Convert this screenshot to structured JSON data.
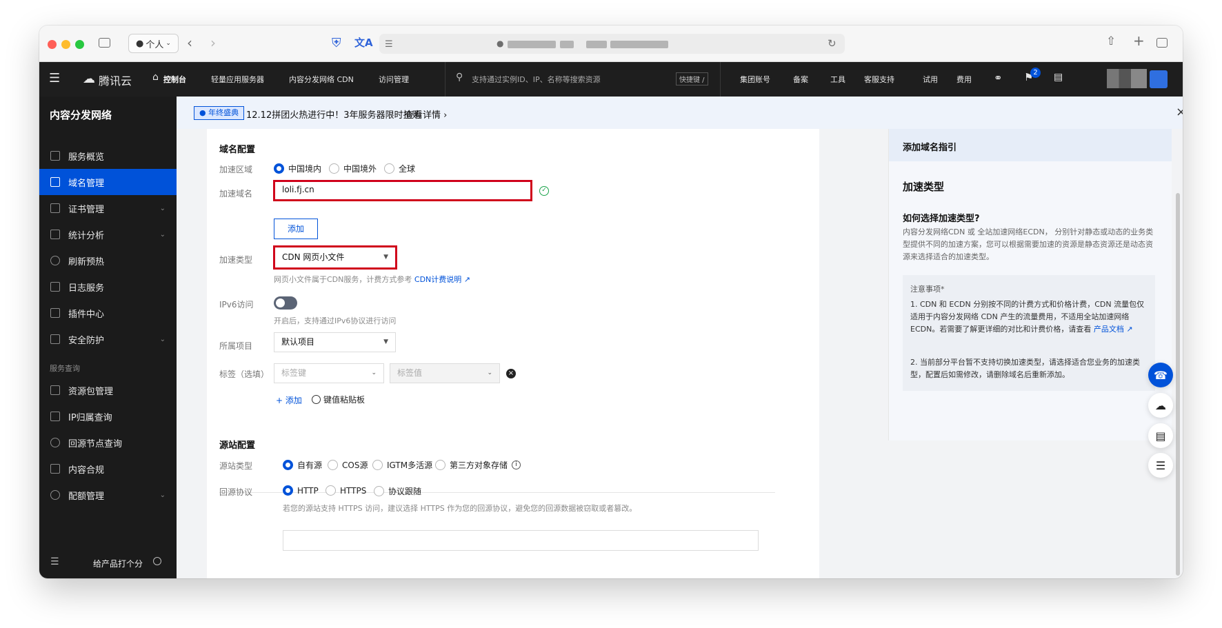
{
  "browser": {
    "profile_label": "个人"
  },
  "topnav": {
    "brand": "腾讯云",
    "console": "控制台",
    "items": [
      "轻量应用服务器",
      "内容分发网络 CDN",
      "访问管理"
    ],
    "search_placeholder": "支持通过实例ID、IP、名称等搜索资源",
    "shortcut": "快捷键 /",
    "right_items": [
      "集团账号",
      "备案",
      "工具",
      "客服支持",
      "试用",
      "费用"
    ],
    "notification_count": "2"
  },
  "sidebar": {
    "title": "内容分发网络",
    "items": [
      {
        "label": "服务概览",
        "icon": "grid-icon"
      },
      {
        "label": "域名管理",
        "icon": "domain-icon",
        "active": true
      },
      {
        "label": "证书管理",
        "icon": "certificate-icon"
      },
      {
        "label": "统计分析",
        "icon": "bar-chart-icon"
      },
      {
        "label": "刷新预热",
        "icon": "refresh-icon"
      },
      {
        "label": "日志服务",
        "icon": "log-icon"
      },
      {
        "label": "插件中心",
        "icon": "plugin-icon"
      },
      {
        "label": "安全防护",
        "icon": "shield-icon"
      }
    ],
    "group_label": "服务查询",
    "group_items": [
      {
        "label": "资源包管理",
        "icon": "package-icon"
      },
      {
        "label": "IP归属查询",
        "icon": "ip-icon"
      },
      {
        "label": "回源节点查询",
        "icon": "search-icon"
      },
      {
        "label": "内容合规",
        "icon": "image-icon"
      },
      {
        "label": "配额管理",
        "icon": "pie-icon"
      }
    ],
    "footer": "给产品打个分"
  },
  "banner": {
    "tag": "年终盛典",
    "text": "12.12拼团火热进行中！3年服务器限时抢购",
    "link": "查看详情"
  },
  "form": {
    "domain_section": "域名配置",
    "region_label": "加速区域",
    "region_options": [
      "中国境内",
      "中国境外",
      "全球"
    ],
    "domain_label": "加速域名",
    "domain_value": "loli.fj.cn",
    "add_button": "添加",
    "type_label": "加速类型",
    "type_value": "CDN 网页小文件",
    "type_help": "网页小文件属于CDN服务，计费方式参考",
    "type_help_link": "CDN计费说明",
    "ipv6_label": "IPv6访问",
    "ipv6_help": "开启后，支持通过IPv6协议进行访问",
    "project_label": "所属项目",
    "project_value": "默认项目",
    "tag_label": "标签（选填）",
    "tag_key_placeholder": "标签键",
    "tag_value_placeholder": "标签值",
    "tag_add": "添加",
    "tag_paste": "键值粘贴板",
    "origin_section": "源站配置",
    "origin_type_label": "源站类型",
    "origin_types": [
      "自有源",
      "COS源",
      "IGTM多活源",
      "第三方对象存储"
    ],
    "protocol_label": "回源协议",
    "protocols": [
      "HTTP",
      "HTTPS",
      "协议跟随"
    ],
    "protocol_help": "若您的源站支持 HTTPS 访问，建议选择 HTTPS 作为您的回源协议，避免您的回源数据被窃取或者篡改。"
  },
  "guide": {
    "header": "添加域名指引",
    "title": "加速类型",
    "question": "如何选择加速类型?",
    "paragraph": "内容分发网络CDN 或 全站加速网络ECDN， 分别针对静态或动态的业务类型提供不同的加速方案，您可以根据需要加速的资源是静态资源还是动态资源来选择适合的加速类型。",
    "note_title": "注意事项*",
    "note_1": "1. CDN 和 ECDN 分别按不同的计费方式和价格计费，CDN 流量包仅适用于内容分发网络 CDN 产生的流量费用，不适用全站加速网络 ECDN。若需要了解更详细的对比和计费价格，请查看",
    "note_1_link": "产品文档",
    "note_2": "2. 当前部分平台暂不支持切换加速类型，请选择适合您业务的加速类型，配置后如需修改，请删除域名后重新添加。"
  }
}
